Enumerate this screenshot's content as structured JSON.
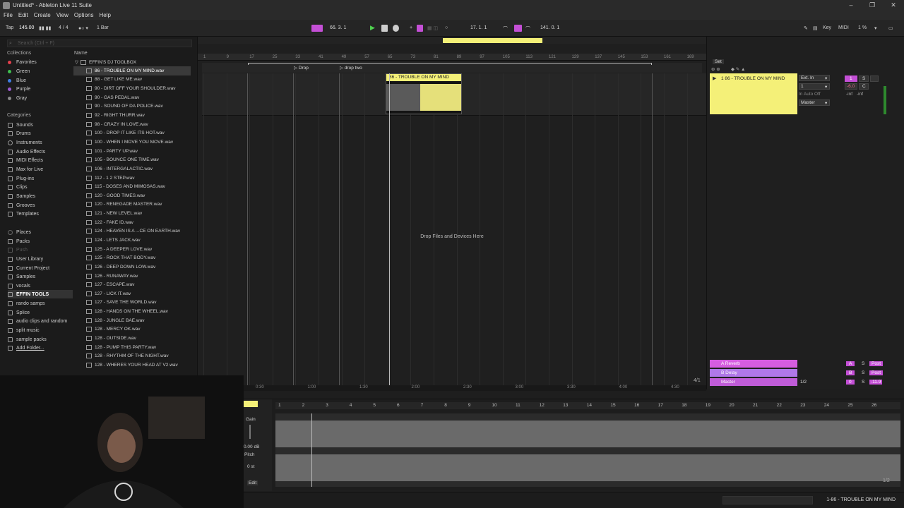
{
  "window": {
    "title": "Untitled* - Ableton Live 11 Suite"
  },
  "menu": [
    "File",
    "Edit",
    "Create",
    "View",
    "Options",
    "Help"
  ],
  "transport": {
    "tap": "Tap",
    "tempo": "145.00",
    "signature": "4 / 4",
    "quantize": "1 Bar",
    "arrangement_position": "66.  3.  1",
    "loop_start": "17.  1.  1",
    "loop_length": "141.  0.  1",
    "key_label": "Key",
    "midi_label": "MIDI",
    "cpu": "1 %"
  },
  "browser": {
    "search_placeholder": "Search (Ctrl + F)",
    "collections_header": "Collections",
    "collections": [
      {
        "label": "Favorites",
        "color": "#e5404d"
      },
      {
        "label": "Green",
        "color": "#3fbf4f"
      },
      {
        "label": "Blue",
        "color": "#3f7fe5"
      },
      {
        "label": "Purple",
        "color": "#9b59d0"
      },
      {
        "label": "Gray",
        "color": "#8a8a8a"
      }
    ],
    "categories_header": "Categories",
    "categories": [
      "Sounds",
      "Drums",
      "Instruments",
      "Audio Effects",
      "MIDI Effects",
      "Max for Live",
      "Plug-ins",
      "Clips",
      "Samples",
      "Grooves",
      "Templates"
    ],
    "places": [
      "Places",
      "Packs",
      "Push",
      "User Library",
      "Current Project",
      "Samples",
      "vocals",
      "EFFIN TOOLS",
      "rando samps",
      "Splice",
      "audio clips and random",
      "split music",
      "sample packs",
      "Add Folder..."
    ],
    "name_header": "Name",
    "folder": "EFFIN'S DJ TOOLBOX",
    "files": [
      "86 - TROUBLE ON MY MIND.wav",
      "88 - GET LIKE ME.wav",
      "90 - DIRT OFF YOUR SHOULDER.wav",
      "90 - GAS PEDAL.wav",
      "90 - SOUND OF DA POLICE.wav",
      "92 - RIGHT THURR.wav",
      "98 - CRAZY IN LOVE.wav",
      "100 - DROP IT LIKE ITS HOT.wav",
      "100 - WHEN I MOVE YOU MOVE.wav",
      "101 - PARTY UP.wav",
      "105 - BOUNCE ONE TIME.wav",
      "106 - INTERGALACTIC.wav",
      "112 - 1 2 STEP.wav",
      "115 - DOSES AND MIMOSAS.wav",
      "120 - GOOD TIMES.wav",
      "120 - RENEGADE MASTER.wav",
      "121 - NEW LEVEL.wav",
      "122 - FAKE ID.wav",
      "124 - HEAVEN IS A ...CE ON EARTH.wav",
      "124 - LETS JACK.wav",
      "125 - A DEEPER LOVE.wav",
      "125 - ROCK THAT BODY.wav",
      "126 - DEEP DOWN LOW.wav",
      "126 - RUNAWAY.wav",
      "127 - ESCAPE.wav",
      "127 - LICK IT.wav",
      "127 - SAVE THE WORLD.wav",
      "128 - HANDS ON THE WHEEL.wav",
      "128 - JUNGLE BAE.wav",
      "128 - MERCY OK.wav",
      "128 - OUTSIDE.wav",
      "128 - PUMP THIS PARTY.wav",
      "128 - RHYTHM OF THE NIGHT.wav",
      "128 - WHERES YOUR HEAD AT V2.wav"
    ]
  },
  "arrangement": {
    "bar_ticks": [
      "1",
      "9",
      "17",
      "25",
      "33",
      "41",
      "49",
      "57",
      "65",
      "73",
      "81",
      "89",
      "97",
      "105",
      "113",
      "121",
      "129",
      "137",
      "145",
      "153",
      "161",
      "169"
    ],
    "locators": [
      "Drop",
      "drop two"
    ],
    "clip_name": "86 - TROUBLE ON MY MIND",
    "drop_message": "Drop Files and Devices Here",
    "time_ticks": [
      "0:30",
      "1:00",
      "1:30",
      "2:00",
      "2:30",
      "3:00",
      "3:30",
      "4:00",
      "4:30"
    ],
    "zoom": "4/1"
  },
  "mixer": {
    "set_label": "Set",
    "track_name": "1 86 - TROUBLE ON MY MIND",
    "input": "Ext. In",
    "input_channel": "1",
    "output": "Master",
    "volume": "-6.0",
    "pan": "C",
    "peak_left": "-inf",
    "peak_right": "-inf",
    "track_number": "1",
    "solo": "S",
    "returns": [
      {
        "name": "A Reverb",
        "letter": "A",
        "solo": "S",
        "post": "Post",
        "color": "#d65de0"
      },
      {
        "name": "B Delay",
        "letter": "B",
        "solo": "S",
        "post": "Post",
        "color": "#b078e8"
      },
      {
        "name": "Master",
        "letter": "0",
        "solo": "S",
        "post": "-11.9",
        "color": "#c05cd8"
      }
    ],
    "master_cue": "1/2"
  },
  "detail": {
    "gain_label": "Gain",
    "gain_value": "0.00 dB",
    "pitch_label": "Pitch",
    "pitch_value": "0 st",
    "edit_label": "Edit",
    "ruler": [
      "1",
      "2",
      "3",
      "4",
      "5",
      "6",
      "7",
      "8",
      "9",
      "10",
      "11",
      "12",
      "13",
      "14",
      "15",
      "16",
      "17",
      "18",
      "19",
      "20",
      "21",
      "22",
      "23",
      "24",
      "25",
      "26"
    ],
    "zoom": "1/2"
  },
  "status": {
    "text": "1-86 - TROUBLE ON MY MIND"
  },
  "colors": {
    "clip": "#f4f078",
    "accent": "#c44fd6",
    "playhead": "#ffffff"
  }
}
